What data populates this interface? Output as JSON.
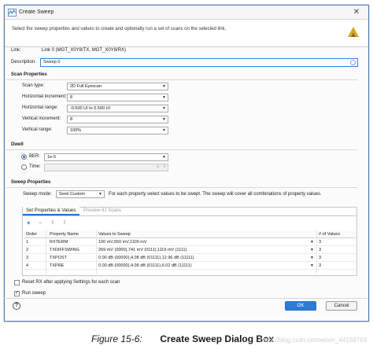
{
  "dialog": {
    "title": "Create Sweep",
    "close_glyph": "✕",
    "header_description": "Select the sweep properties and values to create and optionally run a set of scans on the selected link."
  },
  "link": {
    "label": "Link:",
    "value": "Link 0 (MGT_X0Y8/TX, MGT_X0Y8/RX)"
  },
  "description": {
    "label": "Description:",
    "value": "Sweep 0"
  },
  "scan_properties": {
    "title": "Scan Properties",
    "fields": [
      {
        "label": "Scan type:",
        "value": "2D Full Eyescan"
      },
      {
        "label": "Horizontal increment:",
        "value": "8"
      },
      {
        "label": "Horizontal range:",
        "value": "-0.500 UI to 0.500 UI"
      },
      {
        "label": "Vertical increment:",
        "value": "8"
      },
      {
        "label": "Vertical range:",
        "value": "100%"
      }
    ]
  },
  "dwell": {
    "title": "Dwell",
    "ber_label": "BER:",
    "ber_value": "1e-5",
    "time_label": "Time:",
    "time_value": "0"
  },
  "sweep_properties": {
    "title": "Sweep Properties",
    "mode_label": "Sweep mode:",
    "mode_value": "Semi Custom",
    "mode_note": "For each property select values to be swept. The sweep will cover all combinations of property values.",
    "tabs": [
      "Set Properties & Values",
      "Preview 81 Scans"
    ],
    "toolbar_glyphs": {
      "add": "+",
      "remove": "−",
      "up": "⇧",
      "down": "⇩"
    },
    "table": {
      "headers": [
        "Order",
        "Property Name",
        "Values to Sweep",
        "# of Values"
      ],
      "rows": [
        {
          "order": "1",
          "name": "RXTERM",
          "values": "100 mV,550 mV,1100 mV",
          "count": "3"
        },
        {
          "order": "2",
          "name": "TXDIFFSWING",
          "values": "269 mV (0000),741 mV (0111),1119 mV (1111)",
          "count": "3"
        },
        {
          "order": "3",
          "name": "TXPOST",
          "values": "0.00 dB (00000),4.08 dB (01111),12.96 dB (11111)",
          "count": "3"
        },
        {
          "order": "4",
          "name": "TXPRE",
          "values": "0.00 dB (00000),4.08 dB (01111),6.02 dB (11111)",
          "count": "3"
        }
      ]
    }
  },
  "options": {
    "reset_rx_label": "Reset RX after applying Settings for each scan",
    "reset_rx_checked": false,
    "run_sweep_label": "Run sweep",
    "run_sweep_checked": true
  },
  "footer": {
    "help_glyph": "?",
    "ok_label": "OK",
    "cancel_label": "Cancel"
  },
  "caption": {
    "number": "Figure 15-6:",
    "title": "Create Sweep Dialog Box"
  },
  "watermark": "https://blog.csdn.net/weixin_44159763",
  "colors": {
    "accent": "#2f7bd6",
    "logo": "#d4a52a"
  },
  "icons": {
    "app": "create-sweep-app-icon",
    "logo": "vivado-logo-icon"
  }
}
